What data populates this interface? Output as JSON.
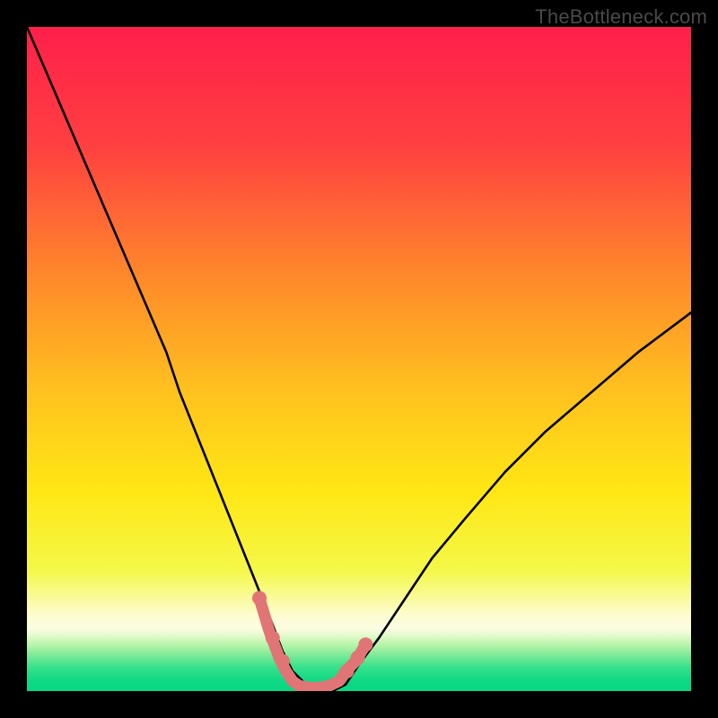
{
  "watermark": "TheBottleneck.com",
  "chart_data": {
    "type": "line",
    "title": "",
    "xlabel": "",
    "ylabel": "",
    "xlim": [
      0,
      100
    ],
    "ylim": [
      0,
      100
    ],
    "grid": false,
    "legend": false,
    "annotations": [],
    "background_gradient": {
      "stops": [
        {
          "pos": 0.0,
          "color": "#ff1f4b"
        },
        {
          "pos": 0.18,
          "color": "#ff4040"
        },
        {
          "pos": 0.38,
          "color": "#ff8a2a"
        },
        {
          "pos": 0.55,
          "color": "#ffc21f"
        },
        {
          "pos": 0.7,
          "color": "#ffe714"
        },
        {
          "pos": 0.82,
          "color": "#f4f84a"
        },
        {
          "pos": 0.885,
          "color": "#fdfccf"
        },
        {
          "pos": 0.905,
          "color": "#fdfde3"
        },
        {
          "pos": 0.915,
          "color": "#e7fbd0"
        },
        {
          "pos": 0.925,
          "color": "#c9f7b5"
        },
        {
          "pos": 0.935,
          "color": "#a7f1a4"
        },
        {
          "pos": 0.95,
          "color": "#6de893"
        },
        {
          "pos": 0.965,
          "color": "#35e08b"
        },
        {
          "pos": 0.985,
          "color": "#0fd985"
        },
        {
          "pos": 1.0,
          "color": "#07d783"
        }
      ]
    },
    "series": [
      {
        "name": "bottleneck-curve",
        "color": "#000000",
        "x": [
          0,
          3,
          6,
          9,
          12,
          15,
          18,
          21,
          23,
          25,
          27,
          29,
          31,
          33,
          35,
          37,
          38.5,
          40,
          42,
          44,
          46,
          48,
          50,
          53,
          57,
          61,
          66,
          72,
          78,
          85,
          92,
          100
        ],
        "y": [
          100,
          93,
          86,
          79,
          72,
          65,
          58,
          51,
          45,
          40,
          35,
          30,
          25,
          20,
          15,
          10,
          6,
          3,
          1,
          0,
          0,
          1,
          4,
          8,
          14,
          20,
          26,
          33,
          39,
          45,
          51,
          57
        ]
      },
      {
        "name": "valley-highlight",
        "color": "#e17475",
        "stroke_width": 13,
        "linecap": "round",
        "x": [
          35,
          36.5,
          38,
          39,
          40,
          41,
          42.5,
          44,
          45.5,
          47,
          48,
          49.5,
          51
        ],
        "y": [
          14,
          9,
          5,
          3,
          1.5,
          0.8,
          0.5,
          0.5,
          0.8,
          1.5,
          3,
          4.5,
          7
        ]
      }
    ],
    "valley_points": {
      "name": "valley-dots",
      "color": "#e17475",
      "radius": 8,
      "x": [
        35,
        37,
        38.5,
        48.2,
        49.8,
        51
      ],
      "y": [
        14,
        8,
        4.5,
        3,
        5,
        7
      ]
    }
  }
}
